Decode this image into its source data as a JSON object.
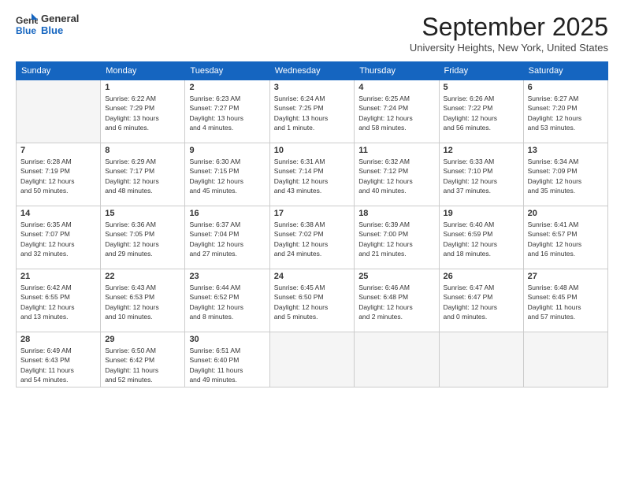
{
  "header": {
    "logo_general": "General",
    "logo_blue": "Blue",
    "month": "September 2025",
    "location": "University Heights, New York, United States"
  },
  "weekdays": [
    "Sunday",
    "Monday",
    "Tuesday",
    "Wednesday",
    "Thursday",
    "Friday",
    "Saturday"
  ],
  "weeks": [
    [
      {
        "day": "",
        "info": ""
      },
      {
        "day": "1",
        "info": "Sunrise: 6:22 AM\nSunset: 7:29 PM\nDaylight: 13 hours\nand 6 minutes."
      },
      {
        "day": "2",
        "info": "Sunrise: 6:23 AM\nSunset: 7:27 PM\nDaylight: 13 hours\nand 4 minutes."
      },
      {
        "day": "3",
        "info": "Sunrise: 6:24 AM\nSunset: 7:25 PM\nDaylight: 13 hours\nand 1 minute."
      },
      {
        "day": "4",
        "info": "Sunrise: 6:25 AM\nSunset: 7:24 PM\nDaylight: 12 hours\nand 58 minutes."
      },
      {
        "day": "5",
        "info": "Sunrise: 6:26 AM\nSunset: 7:22 PM\nDaylight: 12 hours\nand 56 minutes."
      },
      {
        "day": "6",
        "info": "Sunrise: 6:27 AM\nSunset: 7:20 PM\nDaylight: 12 hours\nand 53 minutes."
      }
    ],
    [
      {
        "day": "7",
        "info": "Sunrise: 6:28 AM\nSunset: 7:19 PM\nDaylight: 12 hours\nand 50 minutes."
      },
      {
        "day": "8",
        "info": "Sunrise: 6:29 AM\nSunset: 7:17 PM\nDaylight: 12 hours\nand 48 minutes."
      },
      {
        "day": "9",
        "info": "Sunrise: 6:30 AM\nSunset: 7:15 PM\nDaylight: 12 hours\nand 45 minutes."
      },
      {
        "day": "10",
        "info": "Sunrise: 6:31 AM\nSunset: 7:14 PM\nDaylight: 12 hours\nand 43 minutes."
      },
      {
        "day": "11",
        "info": "Sunrise: 6:32 AM\nSunset: 7:12 PM\nDaylight: 12 hours\nand 40 minutes."
      },
      {
        "day": "12",
        "info": "Sunrise: 6:33 AM\nSunset: 7:10 PM\nDaylight: 12 hours\nand 37 minutes."
      },
      {
        "day": "13",
        "info": "Sunrise: 6:34 AM\nSunset: 7:09 PM\nDaylight: 12 hours\nand 35 minutes."
      }
    ],
    [
      {
        "day": "14",
        "info": "Sunrise: 6:35 AM\nSunset: 7:07 PM\nDaylight: 12 hours\nand 32 minutes."
      },
      {
        "day": "15",
        "info": "Sunrise: 6:36 AM\nSunset: 7:05 PM\nDaylight: 12 hours\nand 29 minutes."
      },
      {
        "day": "16",
        "info": "Sunrise: 6:37 AM\nSunset: 7:04 PM\nDaylight: 12 hours\nand 27 minutes."
      },
      {
        "day": "17",
        "info": "Sunrise: 6:38 AM\nSunset: 7:02 PM\nDaylight: 12 hours\nand 24 minutes."
      },
      {
        "day": "18",
        "info": "Sunrise: 6:39 AM\nSunset: 7:00 PM\nDaylight: 12 hours\nand 21 minutes."
      },
      {
        "day": "19",
        "info": "Sunrise: 6:40 AM\nSunset: 6:59 PM\nDaylight: 12 hours\nand 18 minutes."
      },
      {
        "day": "20",
        "info": "Sunrise: 6:41 AM\nSunset: 6:57 PM\nDaylight: 12 hours\nand 16 minutes."
      }
    ],
    [
      {
        "day": "21",
        "info": "Sunrise: 6:42 AM\nSunset: 6:55 PM\nDaylight: 12 hours\nand 13 minutes."
      },
      {
        "day": "22",
        "info": "Sunrise: 6:43 AM\nSunset: 6:53 PM\nDaylight: 12 hours\nand 10 minutes."
      },
      {
        "day": "23",
        "info": "Sunrise: 6:44 AM\nSunset: 6:52 PM\nDaylight: 12 hours\nand 8 minutes."
      },
      {
        "day": "24",
        "info": "Sunrise: 6:45 AM\nSunset: 6:50 PM\nDaylight: 12 hours\nand 5 minutes."
      },
      {
        "day": "25",
        "info": "Sunrise: 6:46 AM\nSunset: 6:48 PM\nDaylight: 12 hours\nand 2 minutes."
      },
      {
        "day": "26",
        "info": "Sunrise: 6:47 AM\nSunset: 6:47 PM\nDaylight: 12 hours\nand 0 minutes."
      },
      {
        "day": "27",
        "info": "Sunrise: 6:48 AM\nSunset: 6:45 PM\nDaylight: 11 hours\nand 57 minutes."
      }
    ],
    [
      {
        "day": "28",
        "info": "Sunrise: 6:49 AM\nSunset: 6:43 PM\nDaylight: 11 hours\nand 54 minutes."
      },
      {
        "day": "29",
        "info": "Sunrise: 6:50 AM\nSunset: 6:42 PM\nDaylight: 11 hours\nand 52 minutes."
      },
      {
        "day": "30",
        "info": "Sunrise: 6:51 AM\nSunset: 6:40 PM\nDaylight: 11 hours\nand 49 minutes."
      },
      {
        "day": "",
        "info": ""
      },
      {
        "day": "",
        "info": ""
      },
      {
        "day": "",
        "info": ""
      },
      {
        "day": "",
        "info": ""
      }
    ]
  ]
}
